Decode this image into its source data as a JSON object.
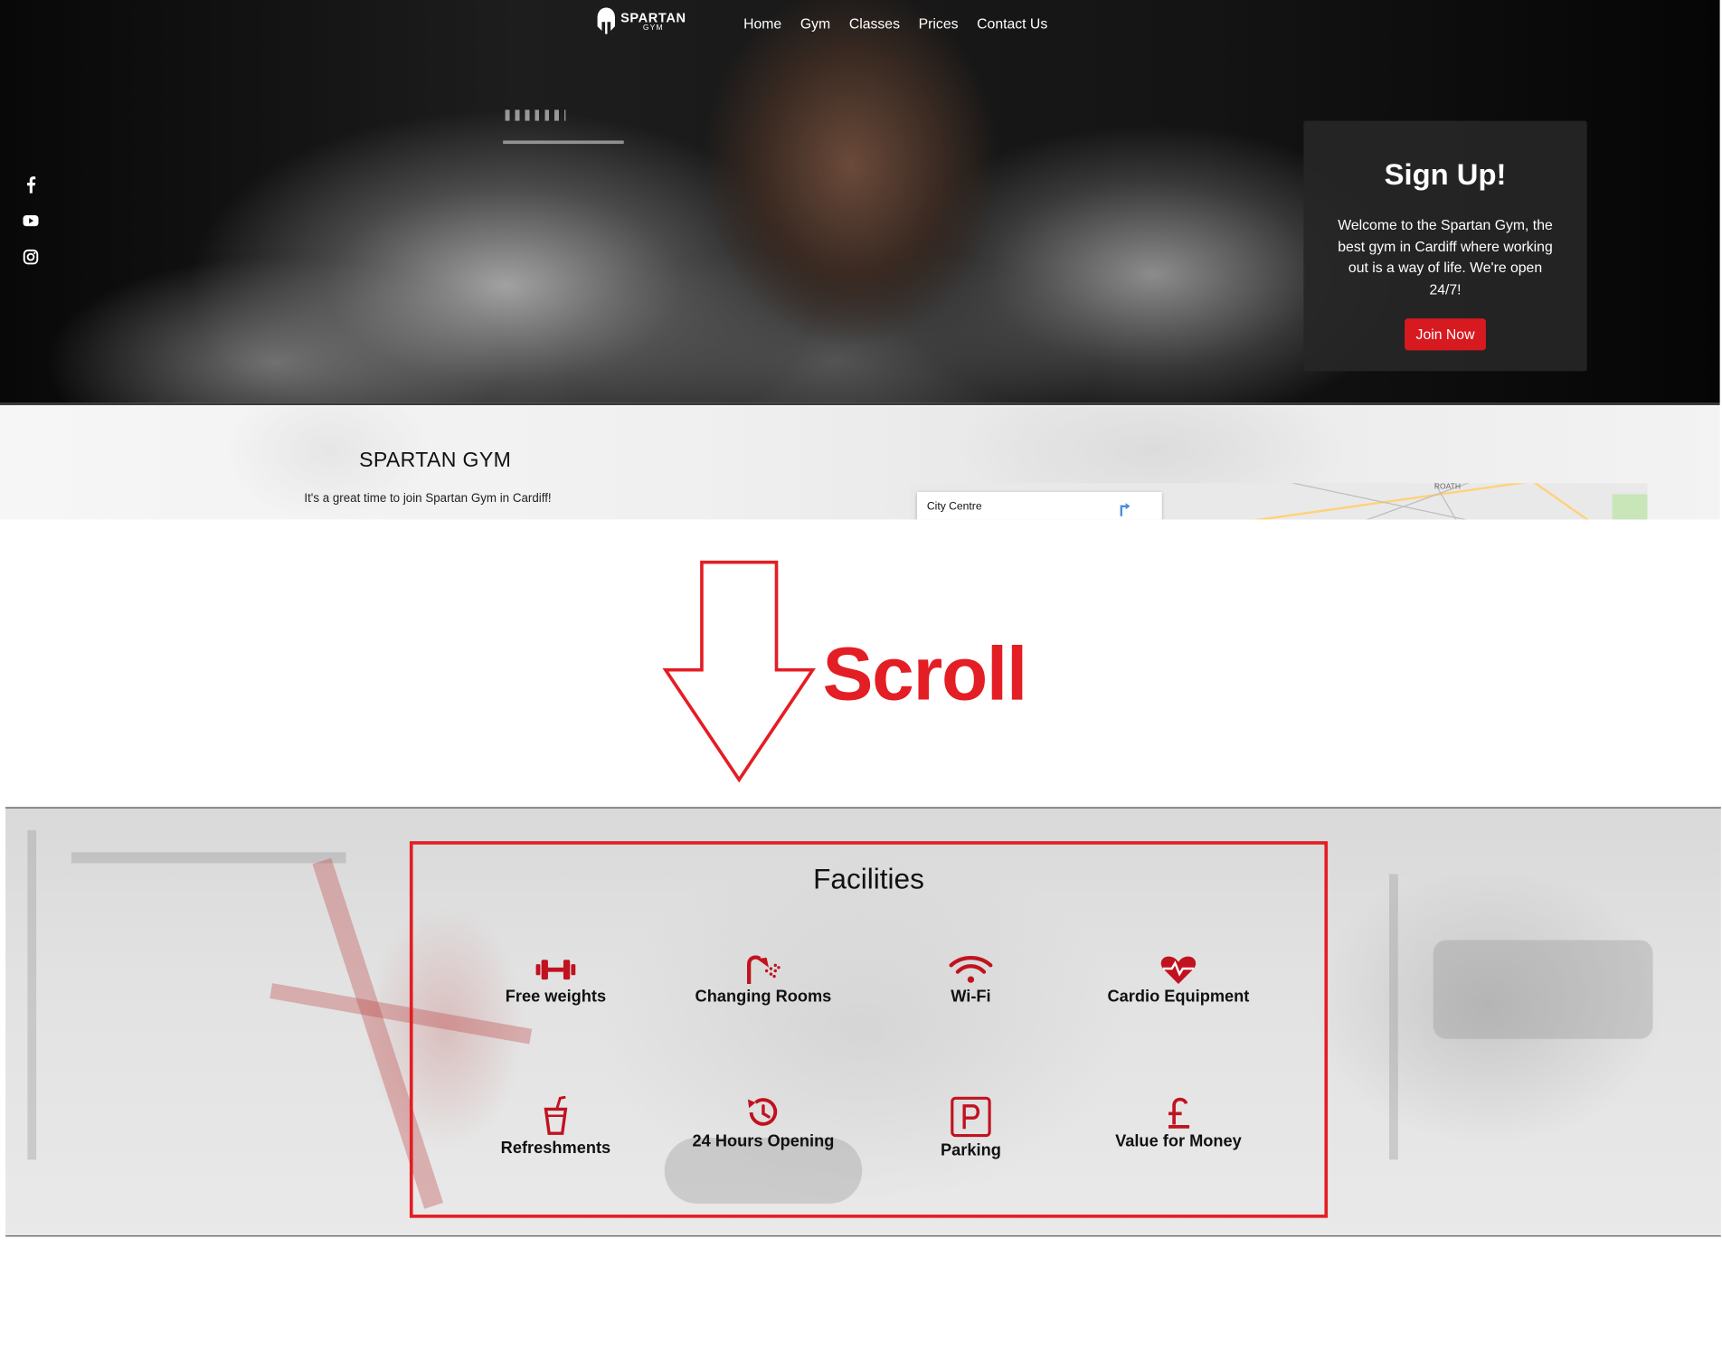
{
  "brand": {
    "name": "SPARTAN",
    "sub": "GYM"
  },
  "nav": {
    "items": [
      "Home",
      "Gym",
      "Classes",
      "Prices",
      "Contact Us"
    ]
  },
  "social": [
    "facebook-icon",
    "youtube-icon",
    "instagram-icon"
  ],
  "signup": {
    "title": "Sign Up!",
    "text": "Welcome to the Spartan Gym, the best gym in Cardiff where working out is a way of life. We're open 24/7!",
    "button": "Join Now"
  },
  "about": {
    "title": "SPARTAN GYM",
    "tagline": "It's a great time to join Spartan Gym in Cardiff!",
    "map_card": "City Centre",
    "map_label": "ROATH"
  },
  "annotation": {
    "scroll": "Scroll"
  },
  "facilities": {
    "title": "Facilities",
    "items": [
      {
        "label": "Free weights",
        "icon": "dumbbell-icon"
      },
      {
        "label": "Changing Rooms",
        "icon": "shower-icon"
      },
      {
        "label": "Wi-Fi",
        "icon": "wifi-icon"
      },
      {
        "label": "Cardio Equipment",
        "icon": "heartbeat-icon"
      },
      {
        "label": "Refreshments",
        "icon": "drink-cup-icon"
      },
      {
        "label": "24 Hours Opening",
        "icon": "history-clock-icon"
      },
      {
        "label": "Parking",
        "icon": "parking-icon"
      },
      {
        "label": "Value for Money",
        "icon": "pound-icon"
      }
    ]
  },
  "colors": {
    "accent": "#d71920",
    "annotation": "#e31e24"
  }
}
